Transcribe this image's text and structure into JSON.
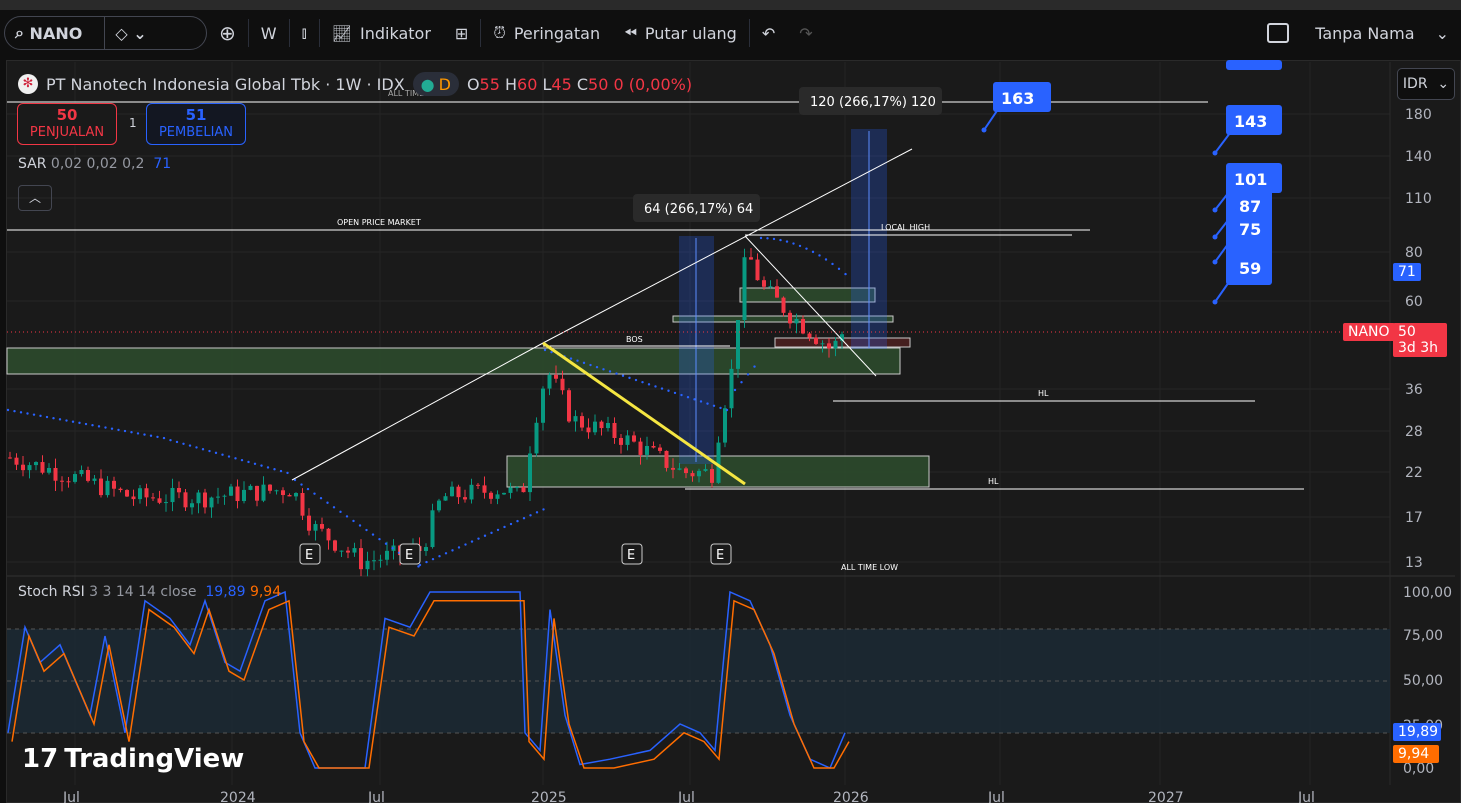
{
  "toolbar": {
    "symbol": "NANO",
    "interval": "W",
    "indicators": "Indikator",
    "alerts": "Peringatan",
    "replay": "Putar ulang",
    "layout_name": "Tanpa Nama"
  },
  "legend": {
    "title": "PT Nanotech Indonesia Global Tbk · 1W · IDX",
    "session": "D",
    "o_label": "O",
    "o": "55",
    "h_label": "H",
    "h": "60",
    "l_label": "L",
    "l": "45",
    "c_label": "C",
    "c": "50",
    "change": "0 (0,00%)"
  },
  "trade": {
    "sell_price": "50",
    "sell_label": "PENJUALAN",
    "spread": "1",
    "buy_price": "51",
    "buy_label": "PEMBELIAN"
  },
  "sar": {
    "label": "SAR",
    "params": "0,02 0,02 0,2",
    "value": "71"
  },
  "stoch": {
    "label": "Stoch RSI",
    "params": "3 3 14 14 close",
    "k": "19,89",
    "d": "9,94"
  },
  "price_axis": {
    "currency": "IDR",
    "ticks": [
      "180",
      "140",
      "110",
      "80",
      "60",
      "36",
      "28",
      "22",
      "17",
      "13"
    ],
    "sar_tag": "71",
    "symbol_tag": "NANO",
    "last_price": "50",
    "countdown": "3d 3h"
  },
  "stoch_axis": {
    "ticks": [
      "100,00",
      "75,00",
      "50,00",
      "25,00",
      "0,00"
    ],
    "k_tag": "19,89",
    "d_tag": "9,94"
  },
  "time_axis": [
    "Jul",
    "2024",
    "Jul",
    "2025",
    "Jul",
    "2026",
    "Jul",
    "2027",
    "Jul"
  ],
  "annotations": {
    "ath": "ALL TIME HIGH",
    "atl": "ALL TIME LOW",
    "open_price": "OPEN PRICE MARKET",
    "local_high": "LOCAL HIGH",
    "bos": "BOS",
    "hl1": "HL",
    "hl2": "HL",
    "measure1": "64 (266,17%) 64",
    "measure2": "120 (266,17%) 120",
    "earnings": "E"
  },
  "callouts": [
    "163",
    "143",
    "101",
    "87",
    "75",
    "59"
  ],
  "brand": "TradingView",
  "colors": {
    "up": "#089981",
    "down": "#f23645",
    "blue": "#2962ff",
    "orange": "#ff6d00"
  }
}
